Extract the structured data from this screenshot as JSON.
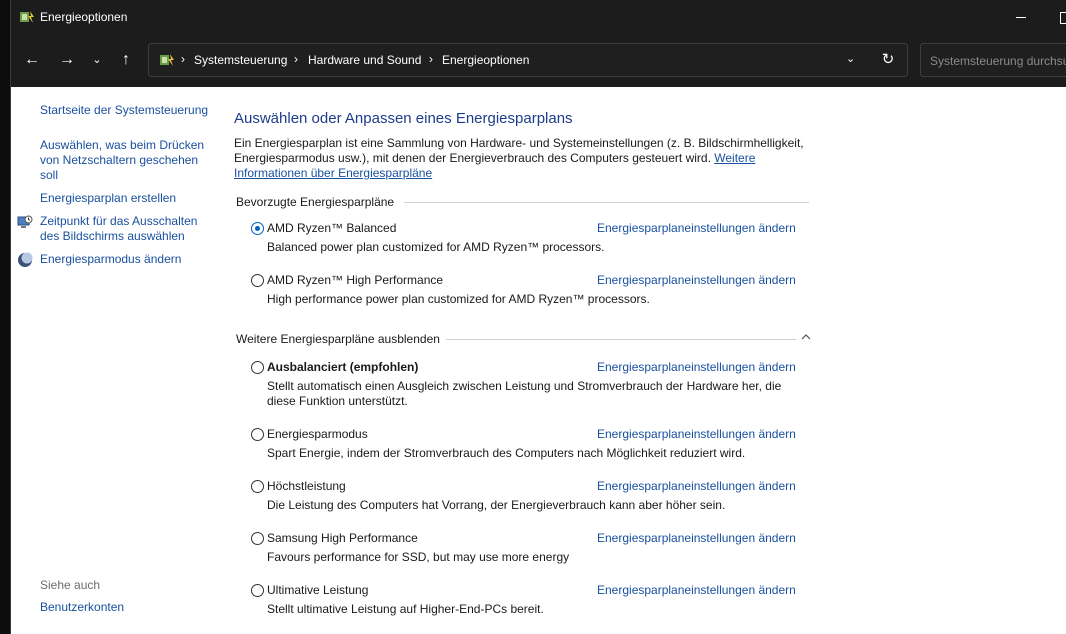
{
  "window": {
    "title": "Energieoptionen"
  },
  "address": {
    "crumbs": [
      "Systemsteuerung",
      "Hardware und Sound",
      "Energieoptionen"
    ]
  },
  "search": {
    "placeholder": "Systemsteuerung durchsuchen"
  },
  "sidebar": {
    "home": "Startseite der Systemsteuerung",
    "items": [
      "Auswählen, was beim Drücken von Netzschaltern geschehen soll",
      "Energiesparplan erstellen",
      "Zeitpunkt für das Ausschalten des Bildschirms auswählen",
      "Energiesparmodus ändern"
    ],
    "see_also": "Siehe auch",
    "user_accounts": "Benutzerkonten"
  },
  "main": {
    "heading": "Auswählen oder Anpassen eines Energiesparplans",
    "intro": "Ein Energiesparplan ist eine Sammlung von Hardware- und Systemeinstellungen (z. B. Bildschirmhelligkeit, Energiesparmodus usw.), mit denen der Energieverbrauch des Computers gesteuert wird.",
    "intro_link": "Weitere Informationen über Energiesparpläne",
    "preferred_label": "Bevorzugte Energiesparpläne",
    "more_label": "Weitere Energiesparpläne ausblenden",
    "change_link": "Energiesparplaneinstellungen ändern",
    "preferred": [
      {
        "name": "AMD Ryzen™ Balanced",
        "desc": "Balanced power plan customized for AMD Ryzen™ processors.",
        "selected": true
      },
      {
        "name": "AMD Ryzen™ High Performance",
        "desc": "High performance power plan customized for AMD Ryzen™ processors.",
        "selected": false
      }
    ],
    "more": [
      {
        "name": "Ausbalanciert (empfohlen)",
        "desc": "Stellt automatisch einen Ausgleich zwischen Leistung und Stromverbrauch der Hardware her, die diese Funktion unterstützt.",
        "selected": false
      },
      {
        "name": "Energiesparmodus",
        "desc": "Spart Energie, indem der Stromverbrauch des Computers nach Möglichkeit reduziert wird.",
        "selected": false
      },
      {
        "name": "Höchstleistung",
        "desc": "Die Leistung des Computers hat Vorrang, der Energieverbrauch kann aber höher sein.",
        "selected": false
      },
      {
        "name": "Samsung High Performance",
        "desc": "Favours performance for SSD, but may use more energy",
        "selected": false
      },
      {
        "name": "Ultimative Leistung",
        "desc": "Stellt ultimative Leistung auf Higher-End-PCs bereit.",
        "selected": false
      }
    ]
  }
}
